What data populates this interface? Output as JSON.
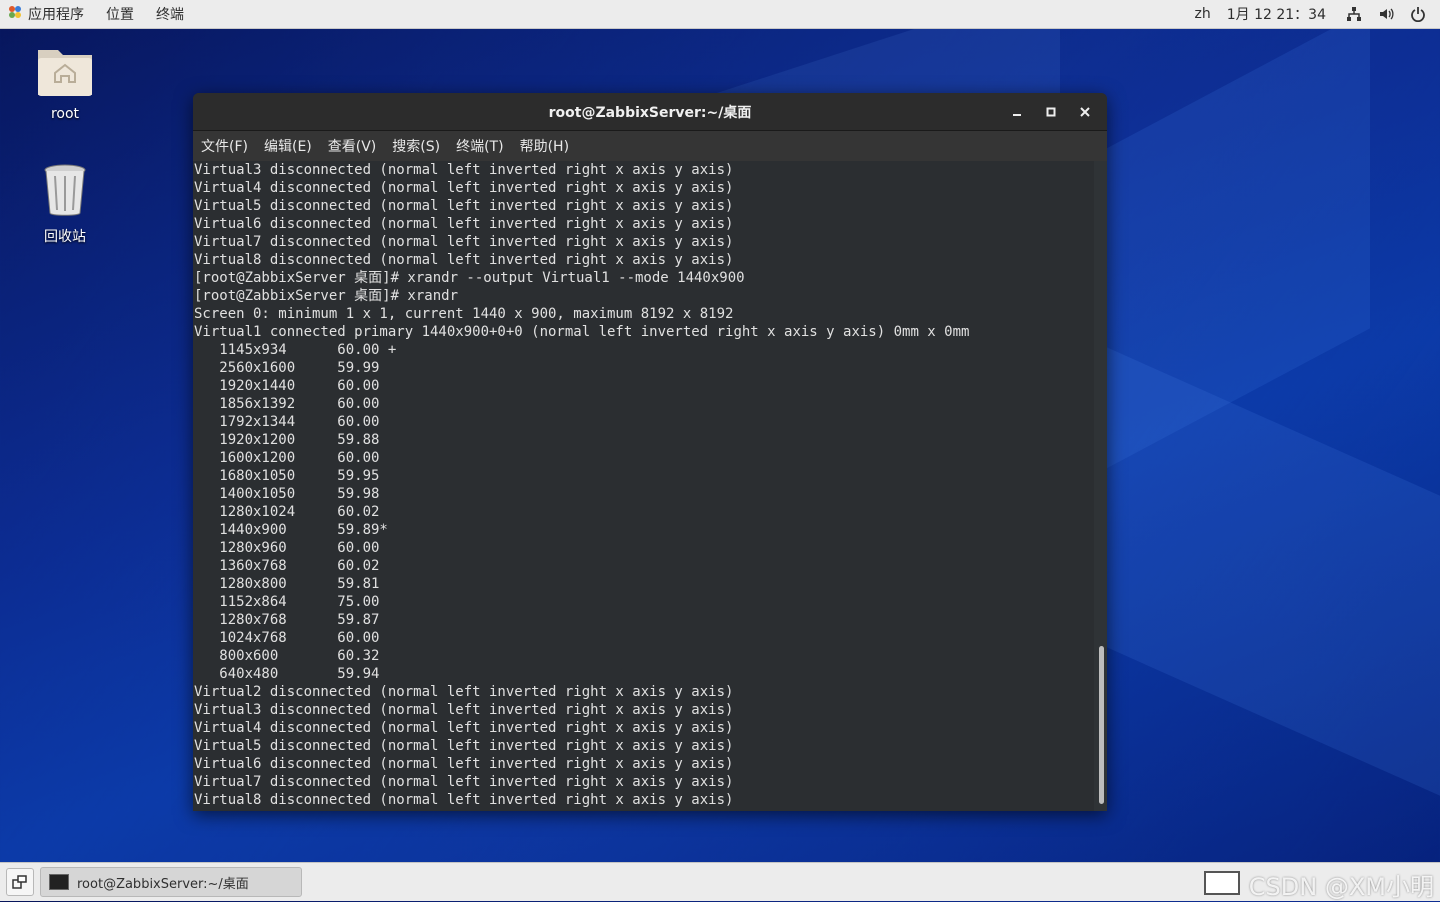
{
  "topbar": {
    "apps_label": "应用程序",
    "places_label": "位置",
    "terminal_label": "终端",
    "input_method": "zh",
    "datetime": "1月 12  21：34"
  },
  "desktop": {
    "home_label": "root",
    "trash_label": "回收站"
  },
  "window": {
    "title": "root@ZabbixServer:~/桌面",
    "menu": [
      "文件(F)",
      "编辑(E)",
      "查看(V)",
      "搜索(S)",
      "终端(T)",
      "帮助(H)"
    ]
  },
  "terminal": {
    "lines": [
      "Virtual3 disconnected (normal left inverted right x axis y axis)",
      "Virtual4 disconnected (normal left inverted right x axis y axis)",
      "Virtual5 disconnected (normal left inverted right x axis y axis)",
      "Virtual6 disconnected (normal left inverted right x axis y axis)",
      "Virtual7 disconnected (normal left inverted right x axis y axis)",
      "Virtual8 disconnected (normal left inverted right x axis y axis)",
      "[root@ZabbixServer 桌面]# xrandr --output Virtual1 --mode 1440x900",
      "[root@ZabbixServer 桌面]# xrandr",
      "Screen 0: minimum 1 x 1, current 1440 x 900, maximum 8192 x 8192",
      "Virtual1 connected primary 1440x900+0+0 (normal left inverted right x axis y axis) 0mm x 0mm",
      "   1145x934      60.00 +",
      "   2560x1600     59.99",
      "   1920x1440     60.00",
      "   1856x1392     60.00",
      "   1792x1344     60.00",
      "   1920x1200     59.88",
      "   1600x1200     60.00",
      "   1680x1050     59.95",
      "   1400x1050     59.98",
      "   1280x1024     60.02",
      "   1440x900      59.89*",
      "   1280x960      60.00",
      "   1360x768      60.02",
      "   1280x800      59.81",
      "   1152x864      75.00",
      "   1280x768      59.87",
      "   1024x768      60.00",
      "   800x600       60.32",
      "   640x480       59.94",
      "Virtual2 disconnected (normal left inverted right x axis y axis)",
      "Virtual3 disconnected (normal left inverted right x axis y axis)",
      "Virtual4 disconnected (normal left inverted right x axis y axis)",
      "Virtual5 disconnected (normal left inverted right x axis y axis)",
      "Virtual6 disconnected (normal left inverted right x axis y axis)",
      "Virtual7 disconnected (normal left inverted right x axis y axis)",
      "Virtual8 disconnected (normal left inverted right x axis y axis)"
    ]
  },
  "taskbar": {
    "task_label": "root@ZabbixServer:~/桌面",
    "watermark": "CSDN @XM小明"
  },
  "icons": {
    "apps": "apps-icon",
    "network": "network-icon",
    "volume": "volume-icon",
    "power": "power-icon",
    "folder": "home-folder-icon",
    "trash": "trash-icon",
    "minimize": "minimize-icon",
    "maximize": "maximize-icon",
    "close": "close-icon",
    "show_desktop": "show-desktop-icon",
    "terminal": "terminal-icon"
  }
}
